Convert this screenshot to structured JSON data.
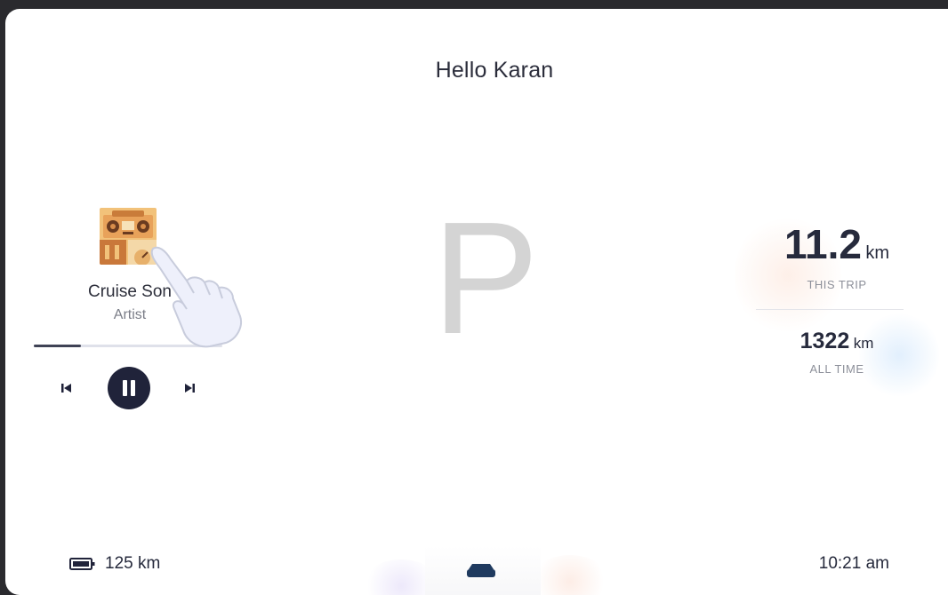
{
  "header": {
    "greeting": "Hello Karan"
  },
  "media": {
    "album_art_icon": "boombox-album-art",
    "song_title": "Cruise Son",
    "artist": "Artist",
    "progress": 0.25,
    "controls": [
      "previous-track",
      "pause",
      "next-track"
    ]
  },
  "gear": {
    "current": "P"
  },
  "trip": {
    "this_trip_value": "11.2",
    "this_trip_unit": "km",
    "this_trip_label": "THIS TRIP",
    "all_time_value": "1322",
    "all_time_unit": "km",
    "all_time_label": "ALL TIME"
  },
  "status_bar": {
    "battery_icon": "battery-icon",
    "range": "125 km",
    "center_icon": "car-icon",
    "time": "10:21 am"
  },
  "colors": {
    "primary_dark": "#20233a",
    "muted_text": "#8d909a",
    "gear_gray": "#d4d4d4",
    "background": "#ffffff"
  }
}
